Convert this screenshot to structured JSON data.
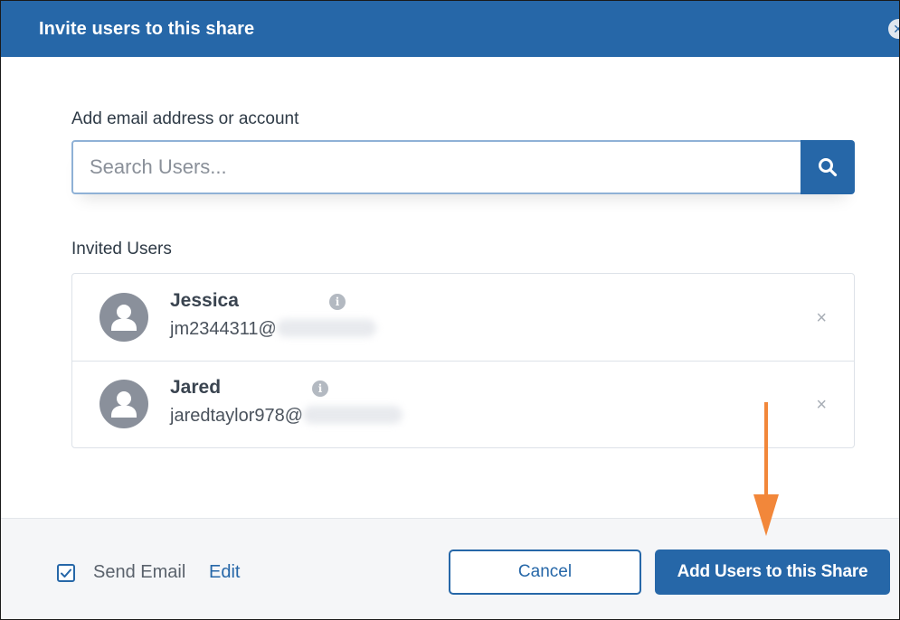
{
  "dialog": {
    "title": "Invite users to this share",
    "close_glyph": "✕"
  },
  "search": {
    "label": "Add email address or account",
    "placeholder": "Search Users..."
  },
  "invited": {
    "label": "Invited Users",
    "users": [
      {
        "name": "Jessica",
        "email_prefix": "jm2344311@"
      },
      {
        "name": "Jared",
        "email_prefix": "jaredtaylor978@"
      }
    ],
    "remove_glyph": "×",
    "info_glyph": "i"
  },
  "footer": {
    "send_email_label": "Send Email",
    "send_email_checked": true,
    "edit_label": "Edit",
    "cancel_label": "Cancel",
    "add_label": "Add Users to this Share"
  },
  "colors": {
    "brand": "#2667a8",
    "annotation_arrow": "#f2873a"
  },
  "icons": {
    "search": "search-icon",
    "avatar": "user-avatar-icon",
    "info": "info-icon",
    "remove": "close-icon",
    "checkbox": "checkmark-icon"
  }
}
